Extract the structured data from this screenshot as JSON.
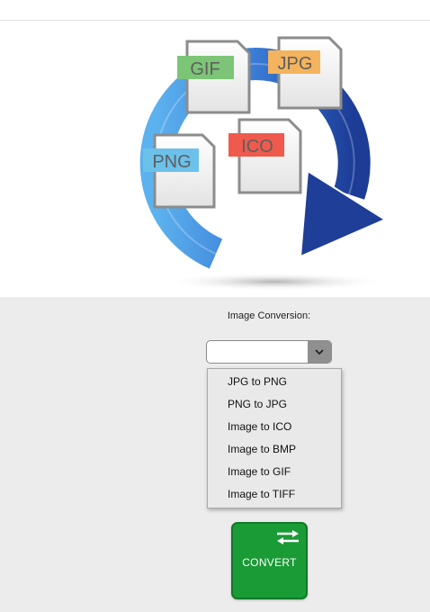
{
  "hero": {
    "badges": [
      {
        "label": "GIF",
        "color": "#7cc576",
        "icon": "gif-file-icon"
      },
      {
        "label": "JPG",
        "color": "#f4b35d",
        "icon": "jpg-file-icon"
      },
      {
        "label": "PNG",
        "color": "#6cc1ea",
        "icon": "png-file-icon"
      },
      {
        "label": "ICO",
        "color": "#ef5a4d",
        "icon": "ico-file-icon"
      }
    ],
    "arrow_colors": {
      "light_blue": "#4a9fe0",
      "dark_blue": "#1e3f9a"
    }
  },
  "form": {
    "label": "Image Conversion:",
    "selected_value": "",
    "dropdown_icon": "chevron-down-icon",
    "options": [
      "JPG to PNG",
      "PNG to JPG",
      "Image to ICO",
      "Image to BMP",
      "Image to GIF",
      "Image to TIFF"
    ]
  },
  "convert_button": {
    "label": "CONVERT",
    "icon": "swap-arrows-icon",
    "color": "#1a9b36"
  }
}
